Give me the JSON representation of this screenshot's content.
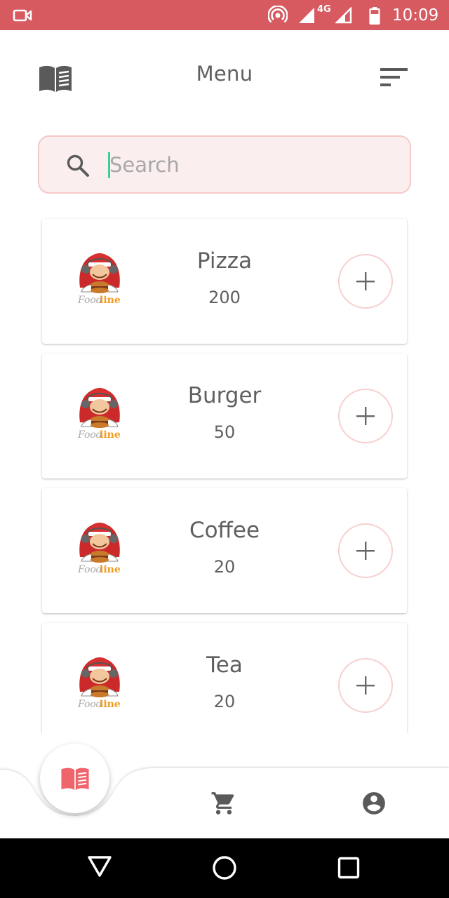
{
  "status_bar": {
    "time": "10:09",
    "network": "4G",
    "icons": [
      "video-camera-icon",
      "hotspot-icon",
      "signal-icon",
      "battery-icon"
    ]
  },
  "header": {
    "title": "Menu",
    "left_icon": "book-icon",
    "right_icon": "sort-icon"
  },
  "search": {
    "placeholder": "Search",
    "value": ""
  },
  "menu_items": [
    {
      "name": "Pizza",
      "price": "200"
    },
    {
      "name": "Burger",
      "price": "50"
    },
    {
      "name": "Coffee",
      "price": "20"
    },
    {
      "name": "Tea",
      "price": "20"
    }
  ],
  "logo": {
    "text_food": "Food",
    "text_line": "line"
  },
  "bottom_nav": {
    "items": [
      "menu-book-icon",
      "cart-icon",
      "account-icon"
    ],
    "active": "menu-book-icon"
  },
  "colors": {
    "accent": "#d65a60",
    "active_icon": "#f0646c",
    "search_bg": "#fbeeee",
    "search_border": "#f6c9c9",
    "text": "#5f5f5f"
  }
}
